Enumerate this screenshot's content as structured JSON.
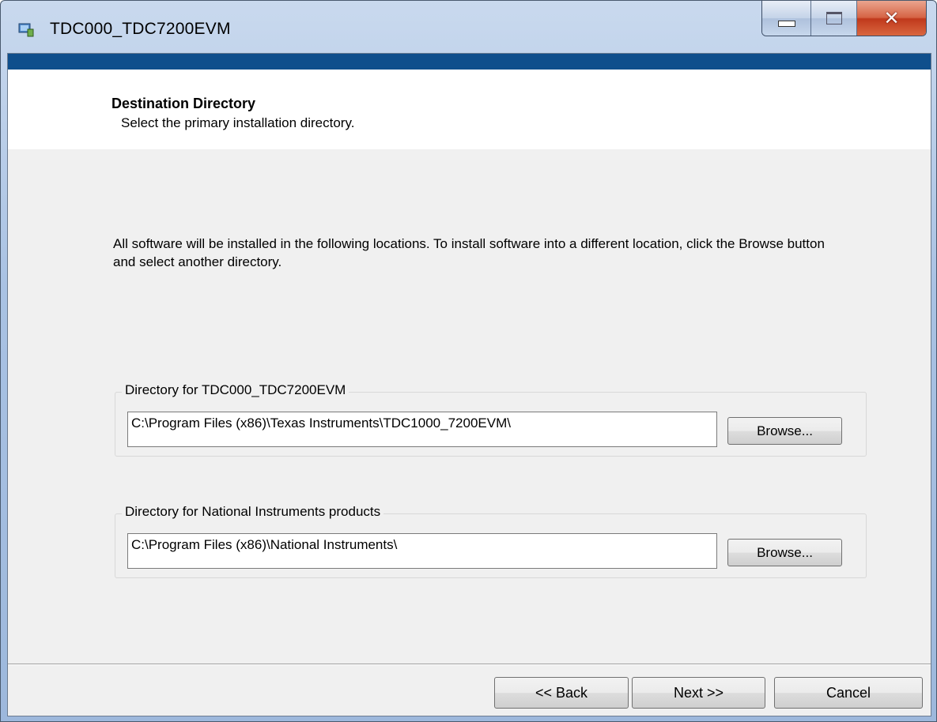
{
  "window": {
    "title": "TDC000_TDC7200EVM",
    "caption_buttons": {
      "minimize": "minimize-icon",
      "maximize": "maximize-icon",
      "close": "close-icon"
    }
  },
  "header": {
    "title": "Destination Directory",
    "subtitle": "Select the primary installation directory."
  },
  "body": {
    "description": "All software will be installed in the following locations. To install software into a different location, click the Browse button and select another directory."
  },
  "directories": [
    {
      "label": "Directory for TDC000_TDC7200EVM",
      "path": "C:\\Program Files (x86)\\Texas Instruments\\TDC1000_7200EVM\\",
      "browse_label": "Browse..."
    },
    {
      "label": "Directory for National Instruments products",
      "path": "C:\\Program Files (x86)\\National Instruments\\",
      "browse_label": "Browse..."
    }
  ],
  "footer": {
    "back_label": "<< Back",
    "next_label": "Next >>",
    "cancel_label": "Cancel"
  },
  "colors": {
    "accent_bar": "#0f4f8c",
    "close_button": "#c8452a",
    "dialog_bg": "#f0f0f0"
  }
}
